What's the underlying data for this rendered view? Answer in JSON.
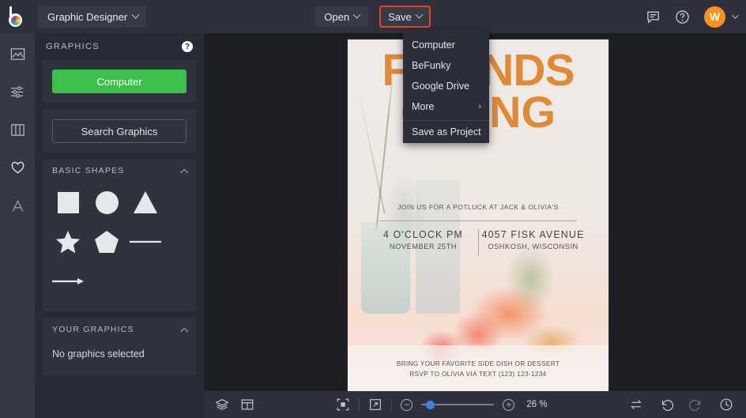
{
  "app": {
    "logo_icon": "befunky-logo-icon",
    "workspace_label": "Graphic Designer"
  },
  "topbar": {
    "open_label": "Open",
    "save_label": "Save",
    "feedback_icon": "chat-bubble-icon",
    "help_icon": "question-circle-icon",
    "avatar_initial": "W",
    "highlight_color": "#e8431f"
  },
  "save_menu": {
    "items": [
      {
        "label": "Computer",
        "has_submenu": false
      },
      {
        "label": "BeFunky",
        "has_submenu": false
      },
      {
        "label": "Google Drive",
        "has_submenu": false
      },
      {
        "label": "More",
        "has_submenu": true,
        "arrow": "›"
      },
      {
        "label": "Save as Project",
        "has_submenu": false
      }
    ]
  },
  "rail": {
    "items": [
      {
        "name": "sidebar-item-photos",
        "icon": "image-icon"
      },
      {
        "name": "sidebar-item-edit",
        "icon": "sliders-icon"
      },
      {
        "name": "sidebar-item-templates",
        "icon": "columns-icon"
      },
      {
        "name": "sidebar-item-graphics",
        "icon": "heart-icon"
      },
      {
        "name": "sidebar-item-text",
        "icon": "text-a-icon"
      }
    ]
  },
  "panel": {
    "title": "GRAPHICS",
    "help_icon": "question-mark-icon",
    "computer_button": "Computer",
    "search_button": "Search Graphics",
    "basic_shapes": {
      "label": "BASIC SHAPES",
      "collapse_icon": "chevron-up-icon",
      "shapes": [
        {
          "name": "shape-square",
          "glyph": "square"
        },
        {
          "name": "shape-circle",
          "glyph": "circle"
        },
        {
          "name": "shape-triangle",
          "glyph": "triangle"
        },
        {
          "name": "shape-star",
          "glyph": "star"
        },
        {
          "name": "shape-pentagon",
          "glyph": "pentagon"
        },
        {
          "name": "shape-line",
          "glyph": "line"
        },
        {
          "name": "shape-arrow",
          "glyph": "arrow"
        }
      ]
    },
    "your_graphics": {
      "label": "YOUR GRAPHICS",
      "collapse_icon": "chevron-up-icon",
      "empty_text": "No graphics selected"
    },
    "green_color": "#3dbf4c"
  },
  "poster": {
    "title_line1": "FRIENDS",
    "title_line2": "GIVING",
    "subtitle": "JOIN US FOR A POTLUCK AT JACK & OLIVIA'S",
    "detail_left_big": "4 O'CLOCK PM",
    "detail_left_small": "NOVEMBER 25TH",
    "detail_right_big": "4057 FISK AVENUE",
    "detail_right_small": "OSHKOSH, WISCONSIN",
    "footer_line1": "BRING YOUR FAVORITE SIDE DISH OR DESSERT",
    "footer_line2": "RSVP TO OLIVIA VIA TEXT (123) 123-1234",
    "accent_color": "#e08a36"
  },
  "bottombar": {
    "layers_icon": "layers-icon",
    "layout_icon": "layout-panel-icon",
    "fit_icon": "fit-to-screen-icon",
    "fullscreen_icon": "expand-arrow-icon",
    "zoom_out_icon": "minus-icon",
    "zoom_in_icon": "plus-icon",
    "zoom_level": "26 %",
    "slider_color": "#3d7fe8",
    "replace_icon": "swap-arrows-icon",
    "undo_icon": "undo-arrow-icon",
    "redo_icon": "redo-arrow-icon",
    "history_icon": "clock-history-icon"
  }
}
